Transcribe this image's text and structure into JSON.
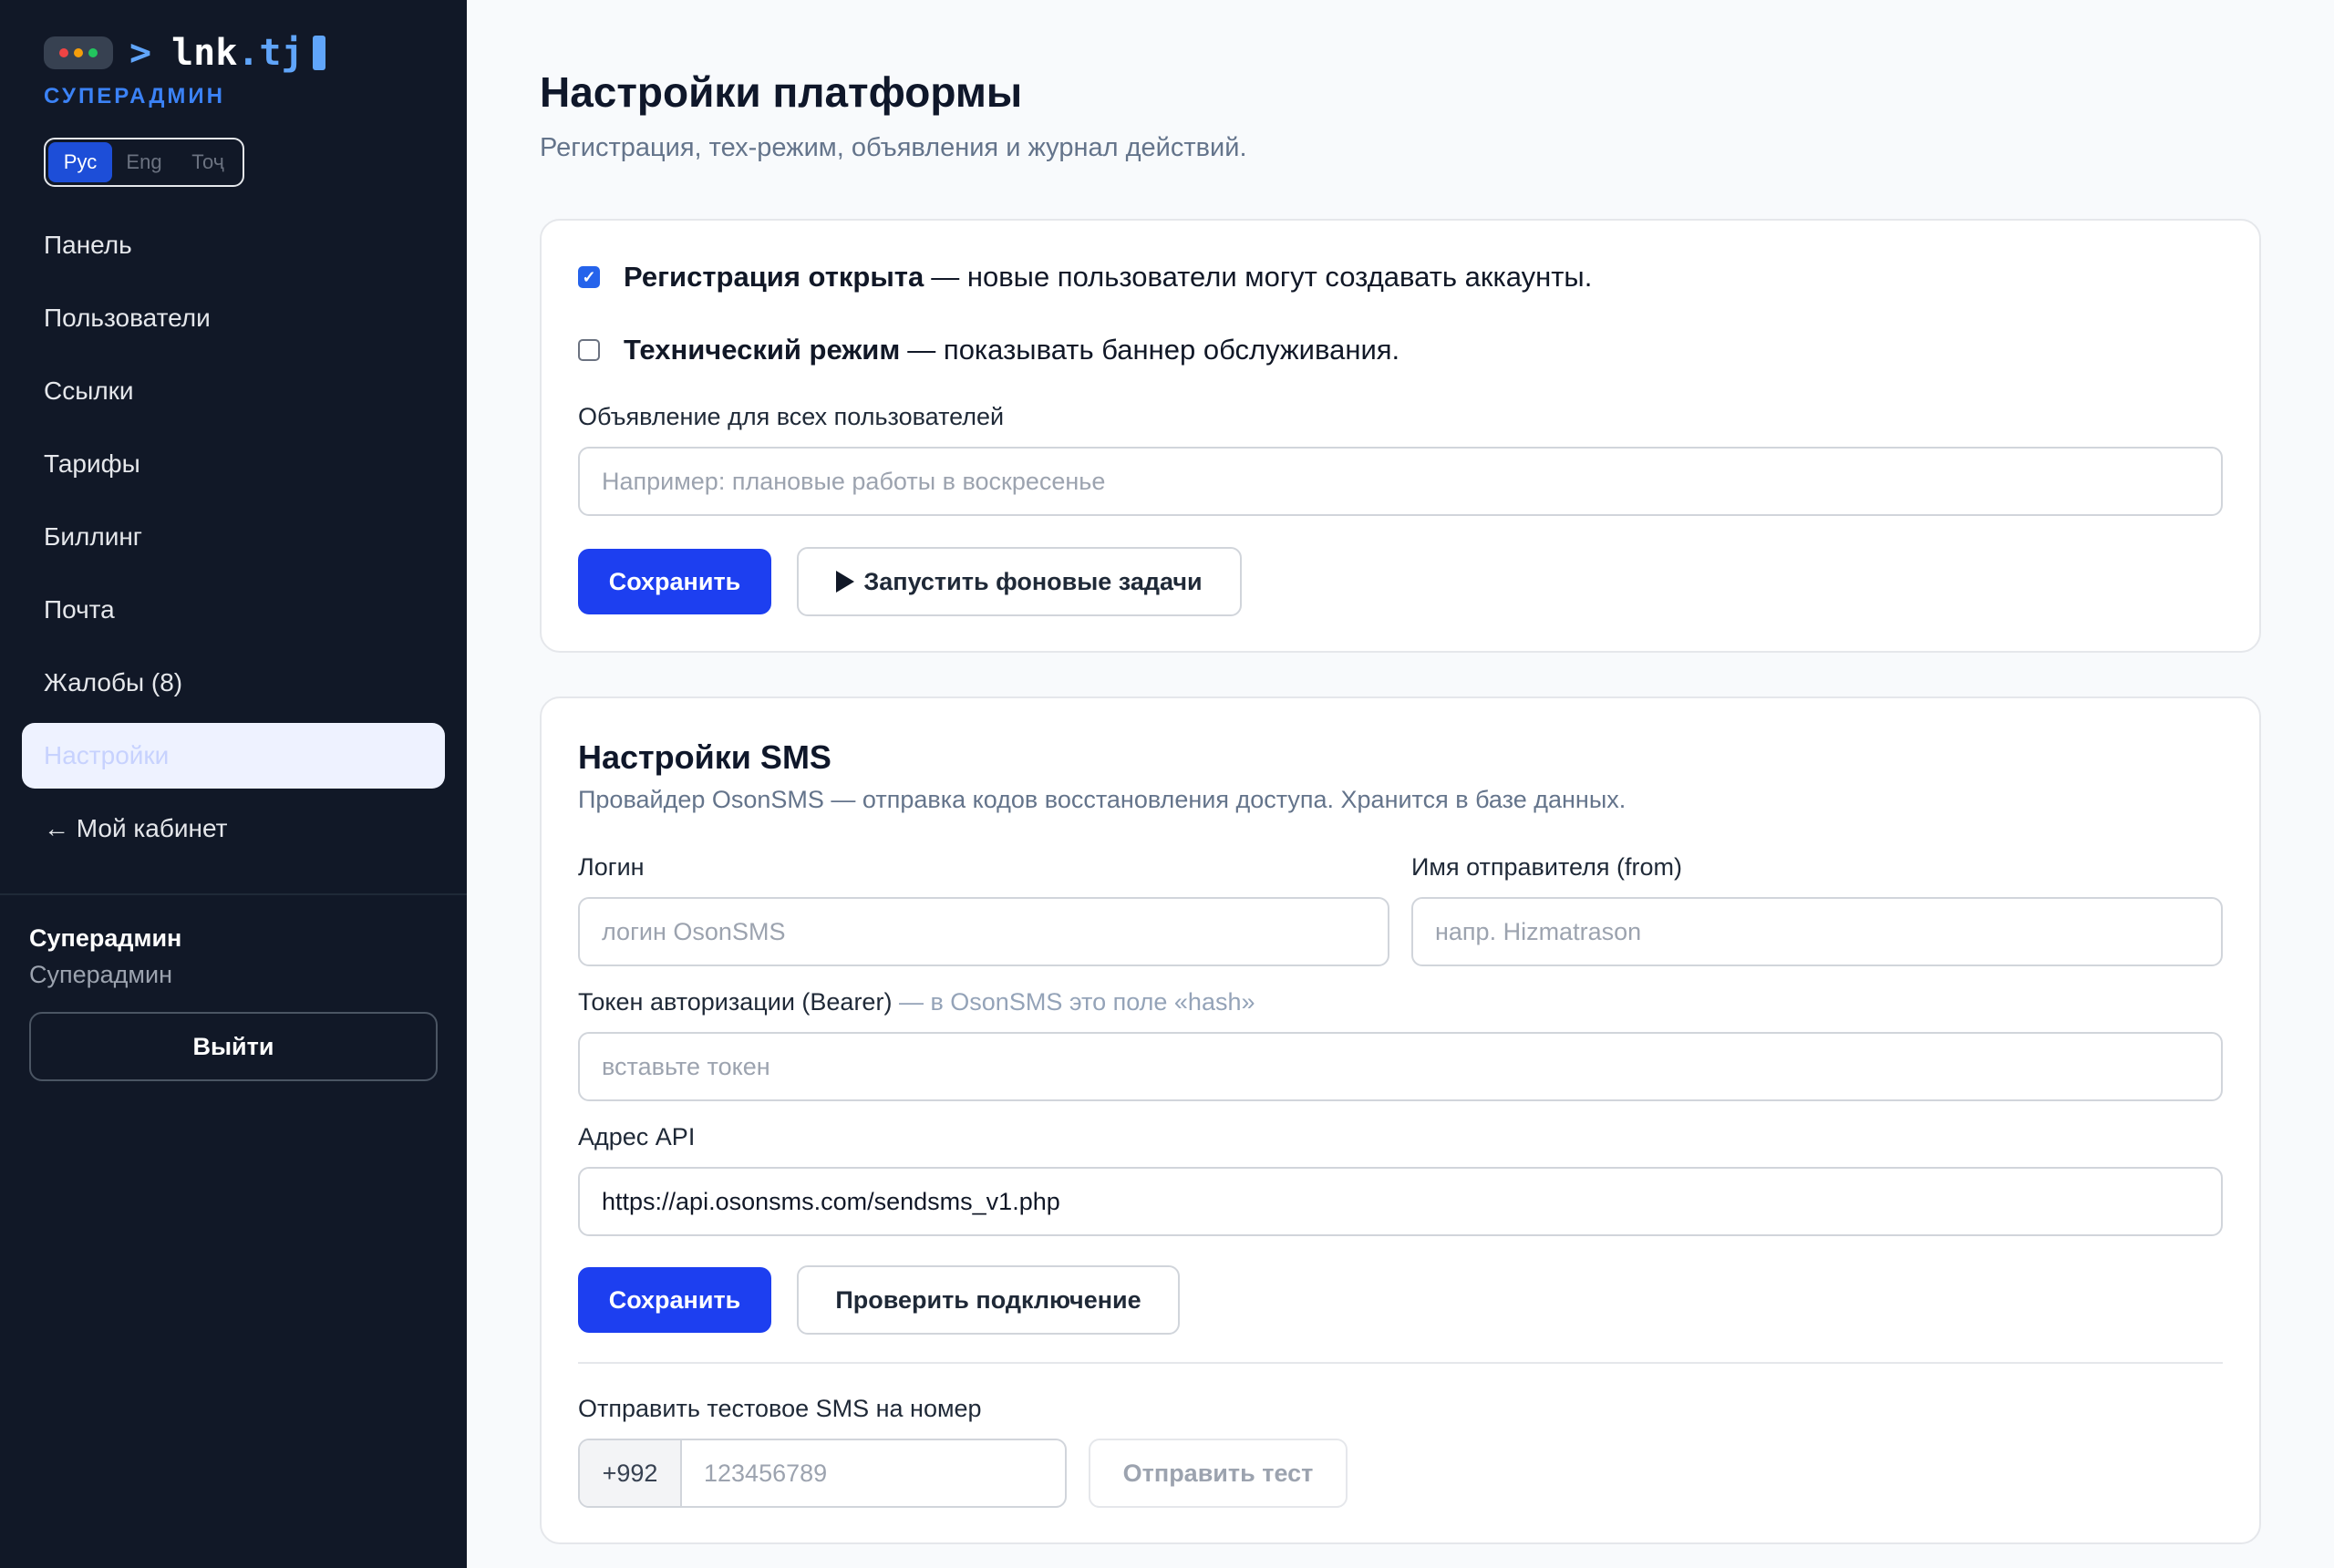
{
  "brand": {
    "prompt": ">",
    "name": "lnk",
    "tld": ".tj",
    "role_label": "СУПЕРАДМИН"
  },
  "colors": {
    "sidebar_bg": "#111827",
    "accent": "#1d3ff0",
    "brand_blue": "#60a5fa",
    "dot_red": "#ef4444",
    "dot_yellow": "#f59e0b",
    "dot_green": "#22c55e"
  },
  "languages": [
    {
      "label": "Рус",
      "active": true
    },
    {
      "label": "Eng",
      "active": false
    },
    {
      "label": "Тоҷ",
      "active": false
    }
  ],
  "nav": [
    {
      "label": "Панель"
    },
    {
      "label": "Пользователи"
    },
    {
      "label": "Ссылки"
    },
    {
      "label": "Тарифы"
    },
    {
      "label": "Биллинг"
    },
    {
      "label": "Почта"
    },
    {
      "label": "Жалобы (8)"
    },
    {
      "label": "Настройки",
      "active": true
    },
    {
      "label": "← Мой кабинет"
    }
  ],
  "user": {
    "name": "Суперадмин",
    "role": "Суперадмин",
    "logout_label": "Выйти"
  },
  "page": {
    "title": "Настройки платформы",
    "subtitle": "Регистрация, тех-режим, объявления и журнал действий."
  },
  "platform": {
    "registration": {
      "checked": true,
      "title": "Регистрация открыта",
      "desc": "— новые пользователи могут создавать аккаунты."
    },
    "maintenance": {
      "checked": false,
      "title": "Технический режим",
      "desc": "— показывать баннер обслуживания."
    },
    "announcement_label": "Объявление для всех пользователей",
    "announcement_placeholder": "Например: плановые работы в воскресенье",
    "save_label": "Сохранить",
    "run_jobs_label": "Запустить фоновые задачи",
    "run_jobs_icon": "play-icon"
  },
  "sms": {
    "title": "Настройки SMS",
    "subtitle": "Провайдер OsonSMS — отправка кодов восстановления доступа. Хранится в базе данных.",
    "login_label": "Логин",
    "login_placeholder": "логин OsonSMS",
    "sender_label": "Имя отправителя (from)",
    "sender_placeholder": "напр. Hizmatrason",
    "token_label": "Токен авторизации (Bearer)",
    "token_hint": " — в OsonSMS это поле «hash»",
    "token_placeholder": "вставьте токен",
    "api_label": "Адрес API",
    "api_value": "https://api.osonsms.com/sendsms_v1.php",
    "save_label": "Сохранить",
    "check_label": "Проверить подключение",
    "test_label": "Отправить тестовое SMS на номер",
    "phone_prefix": "+992",
    "phone_placeholder": "123456789",
    "send_test_label": "Отправить тест"
  }
}
